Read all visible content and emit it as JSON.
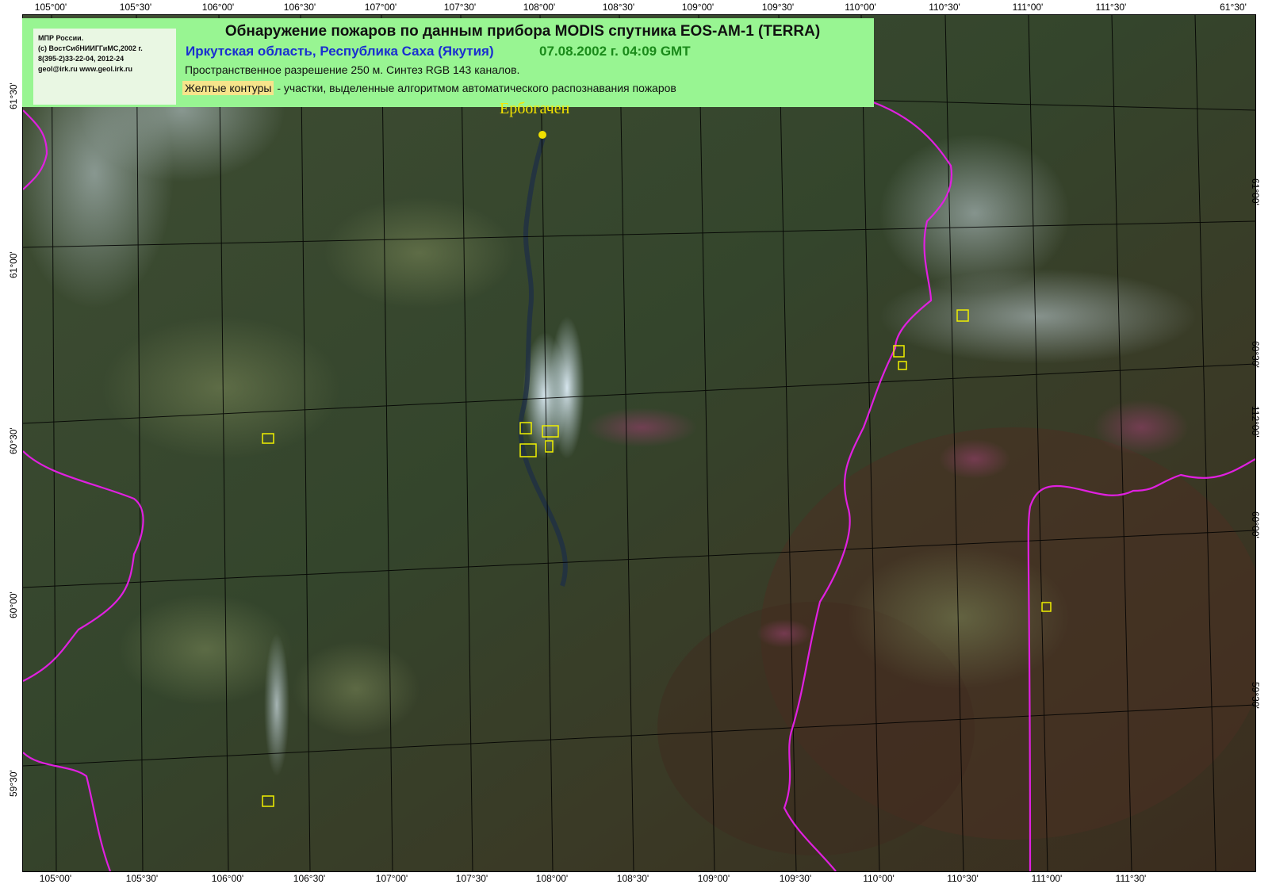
{
  "header": {
    "org_lines": [
      "МПР России.",
      "(с) ВостСибНИИГГиМС,2002 г.",
      "8(395-2)33-22-04, 2012-24",
      "geol@irk.ru  www.geol.irk.ru"
    ],
    "title": "Обнаружение пожаров по данным прибора MODIS спутника EOS-AM-1 (TERRA)",
    "region": "Иркутская область, Республика Саха (Якутия)",
    "datetime": "07.08.2002 г. 04:09 GMT",
    "resolution": "Пространственное разрешение 250 м. Синтез RGB 143 каналов.",
    "legend_highlight": "Желтые контуры",
    "legend_rest": " - участки, выделенные алгоритмом автоматического распознавания пожаров"
  },
  "town": {
    "name": "Ербогачен"
  },
  "ticks": {
    "top": [
      "105°00'",
      "105°30'",
      "106°00'",
      "106°30'",
      "107°00'",
      "107°30'",
      "108°00'",
      "108°30'",
      "109°00'",
      "109°30'",
      "110°00'",
      "110°30'",
      "111°00'",
      "111°30'",
      "61°30'"
    ],
    "bottom": [
      "105°00'",
      "105°30'",
      "106°00'",
      "106°30'",
      "107°00'",
      "107°30'",
      "108°00'",
      "108°30'",
      "109°00'",
      "109°30'",
      "110°00'",
      "110°30'",
      "111°00'",
      "111°30'"
    ],
    "left": [
      "61°30'",
      "61°00'",
      "60°30'",
      "60°00'",
      "59°30'"
    ],
    "right": [
      "61°00'",
      "60°30'",
      "112°00'",
      "60°00'",
      "59°30'"
    ]
  },
  "colors": {
    "boundary": "#e020e0",
    "fire_outline": "#f0f000",
    "grid": "#000000",
    "header_bg": "#98f592"
  }
}
